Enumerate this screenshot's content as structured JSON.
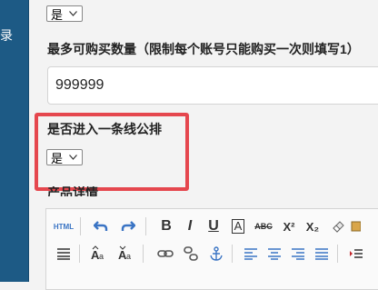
{
  "sidebar": {
    "label": "录"
  },
  "form": {
    "top_select": {
      "value": "是"
    },
    "max_purchase": {
      "label": "最多可购买数量（限制每个账号只能购买一次则填写1）",
      "value": "999999"
    },
    "group_line": {
      "label": "是否进入一条线公排",
      "select_value": "是"
    },
    "product_detail": {
      "label": "产品详情"
    }
  },
  "editor": {
    "toolbar_row1": [
      "html-source",
      "undo",
      "redo",
      "bold",
      "italic",
      "underline",
      "font-border",
      "strikethrough",
      "superscript",
      "subscript",
      "eraser",
      "more"
    ],
    "toolbar_row2": [
      "paragraph",
      "font-size-up",
      "font-size-down",
      "link",
      "unlink",
      "anchor",
      "align-left",
      "align-center",
      "align-right",
      "align-justify",
      "indent"
    ],
    "html_label": "HTML",
    "bold_label": "B",
    "italic_label": "I",
    "underline_label": "U",
    "border_label": "A",
    "strike_label": "ABC",
    "superscript_label": "X²",
    "subscript_label": "X₂"
  },
  "colors": {
    "sidebar": "#1d5a85",
    "highlight": "#e5474e",
    "icon_blue": "#3a74c4"
  }
}
